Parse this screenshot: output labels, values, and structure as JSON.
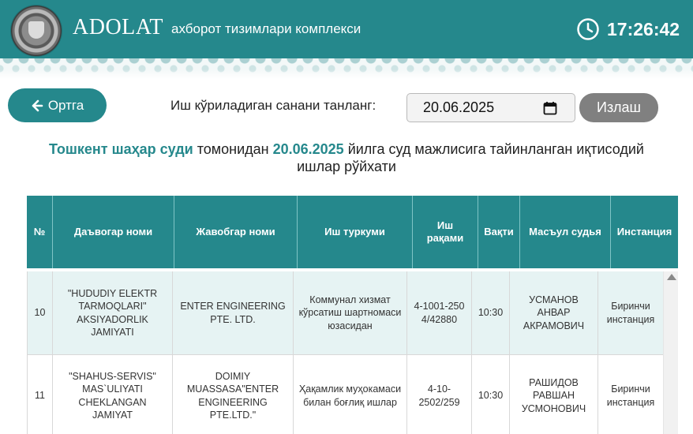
{
  "header": {
    "brand": "ADOLAT",
    "subtitle": "ахборот тизимлари комплекси",
    "time": "17:26:42"
  },
  "controls": {
    "back_label": "Ортга",
    "date_label": "Иш кўриладиган санани танланг:",
    "date_value": "20.06.2025",
    "search_label": "Излаш"
  },
  "heading": {
    "court": "Тошкент шаҳар суди",
    "mid": " томонидан ",
    "date": "20.06.2025",
    "rest": " йилга суд мажлисига тайинланган иқтисодий ишлар рўйхати"
  },
  "table": {
    "columns": [
      "№",
      "Даъвогар номи",
      "Жавобгар номи",
      "Иш туркуми",
      "Иш рақами",
      "Вақти",
      "Масъул судья",
      "Инстанция"
    ],
    "rows": [
      {
        "num": "10",
        "plaintiff": "\"HUDUDIY ELEKTR TARMOQLARI\" AKSIYADORLIK JAMIYATI",
        "defendant": "ENTER ENGINEERING PTE. LTD.",
        "category": "Коммунал хизмат кўрсатиш шартномаси юзасидан",
        "case_no": "4-1001-2504/42880",
        "time": "10:30",
        "judge": "УСМАНОВ АНВАР АКРАМОВИЧ",
        "instance": "Биринчи инстанция"
      },
      {
        "num": "11",
        "plaintiff": "\"SHAHUS-SERVIS\" MAS`ULIYATI CHEKLANGAN JAMIYAT",
        "defendant": "DOIMIY MUASSASA\"ENTER ENGINEERING PTE.LTD.\"",
        "category": "Ҳақамлик муҳокамаси билан боғлиқ ишлар",
        "case_no": "4-10-2502/259",
        "time": "10:30",
        "judge": "РАШИДОВ РАВШАН УСМОНОВИЧ",
        "instance": "Биринчи инстанция"
      }
    ]
  },
  "colors": {
    "primary": "#25888c",
    "row_alt": "#e6f3f3",
    "search_button": "#808080"
  },
  "icons": {
    "clock": "clock-icon",
    "back": "arrow-left-icon",
    "calendar": "calendar-icon",
    "scroll_up": "scroll-up-arrow-icon"
  }
}
